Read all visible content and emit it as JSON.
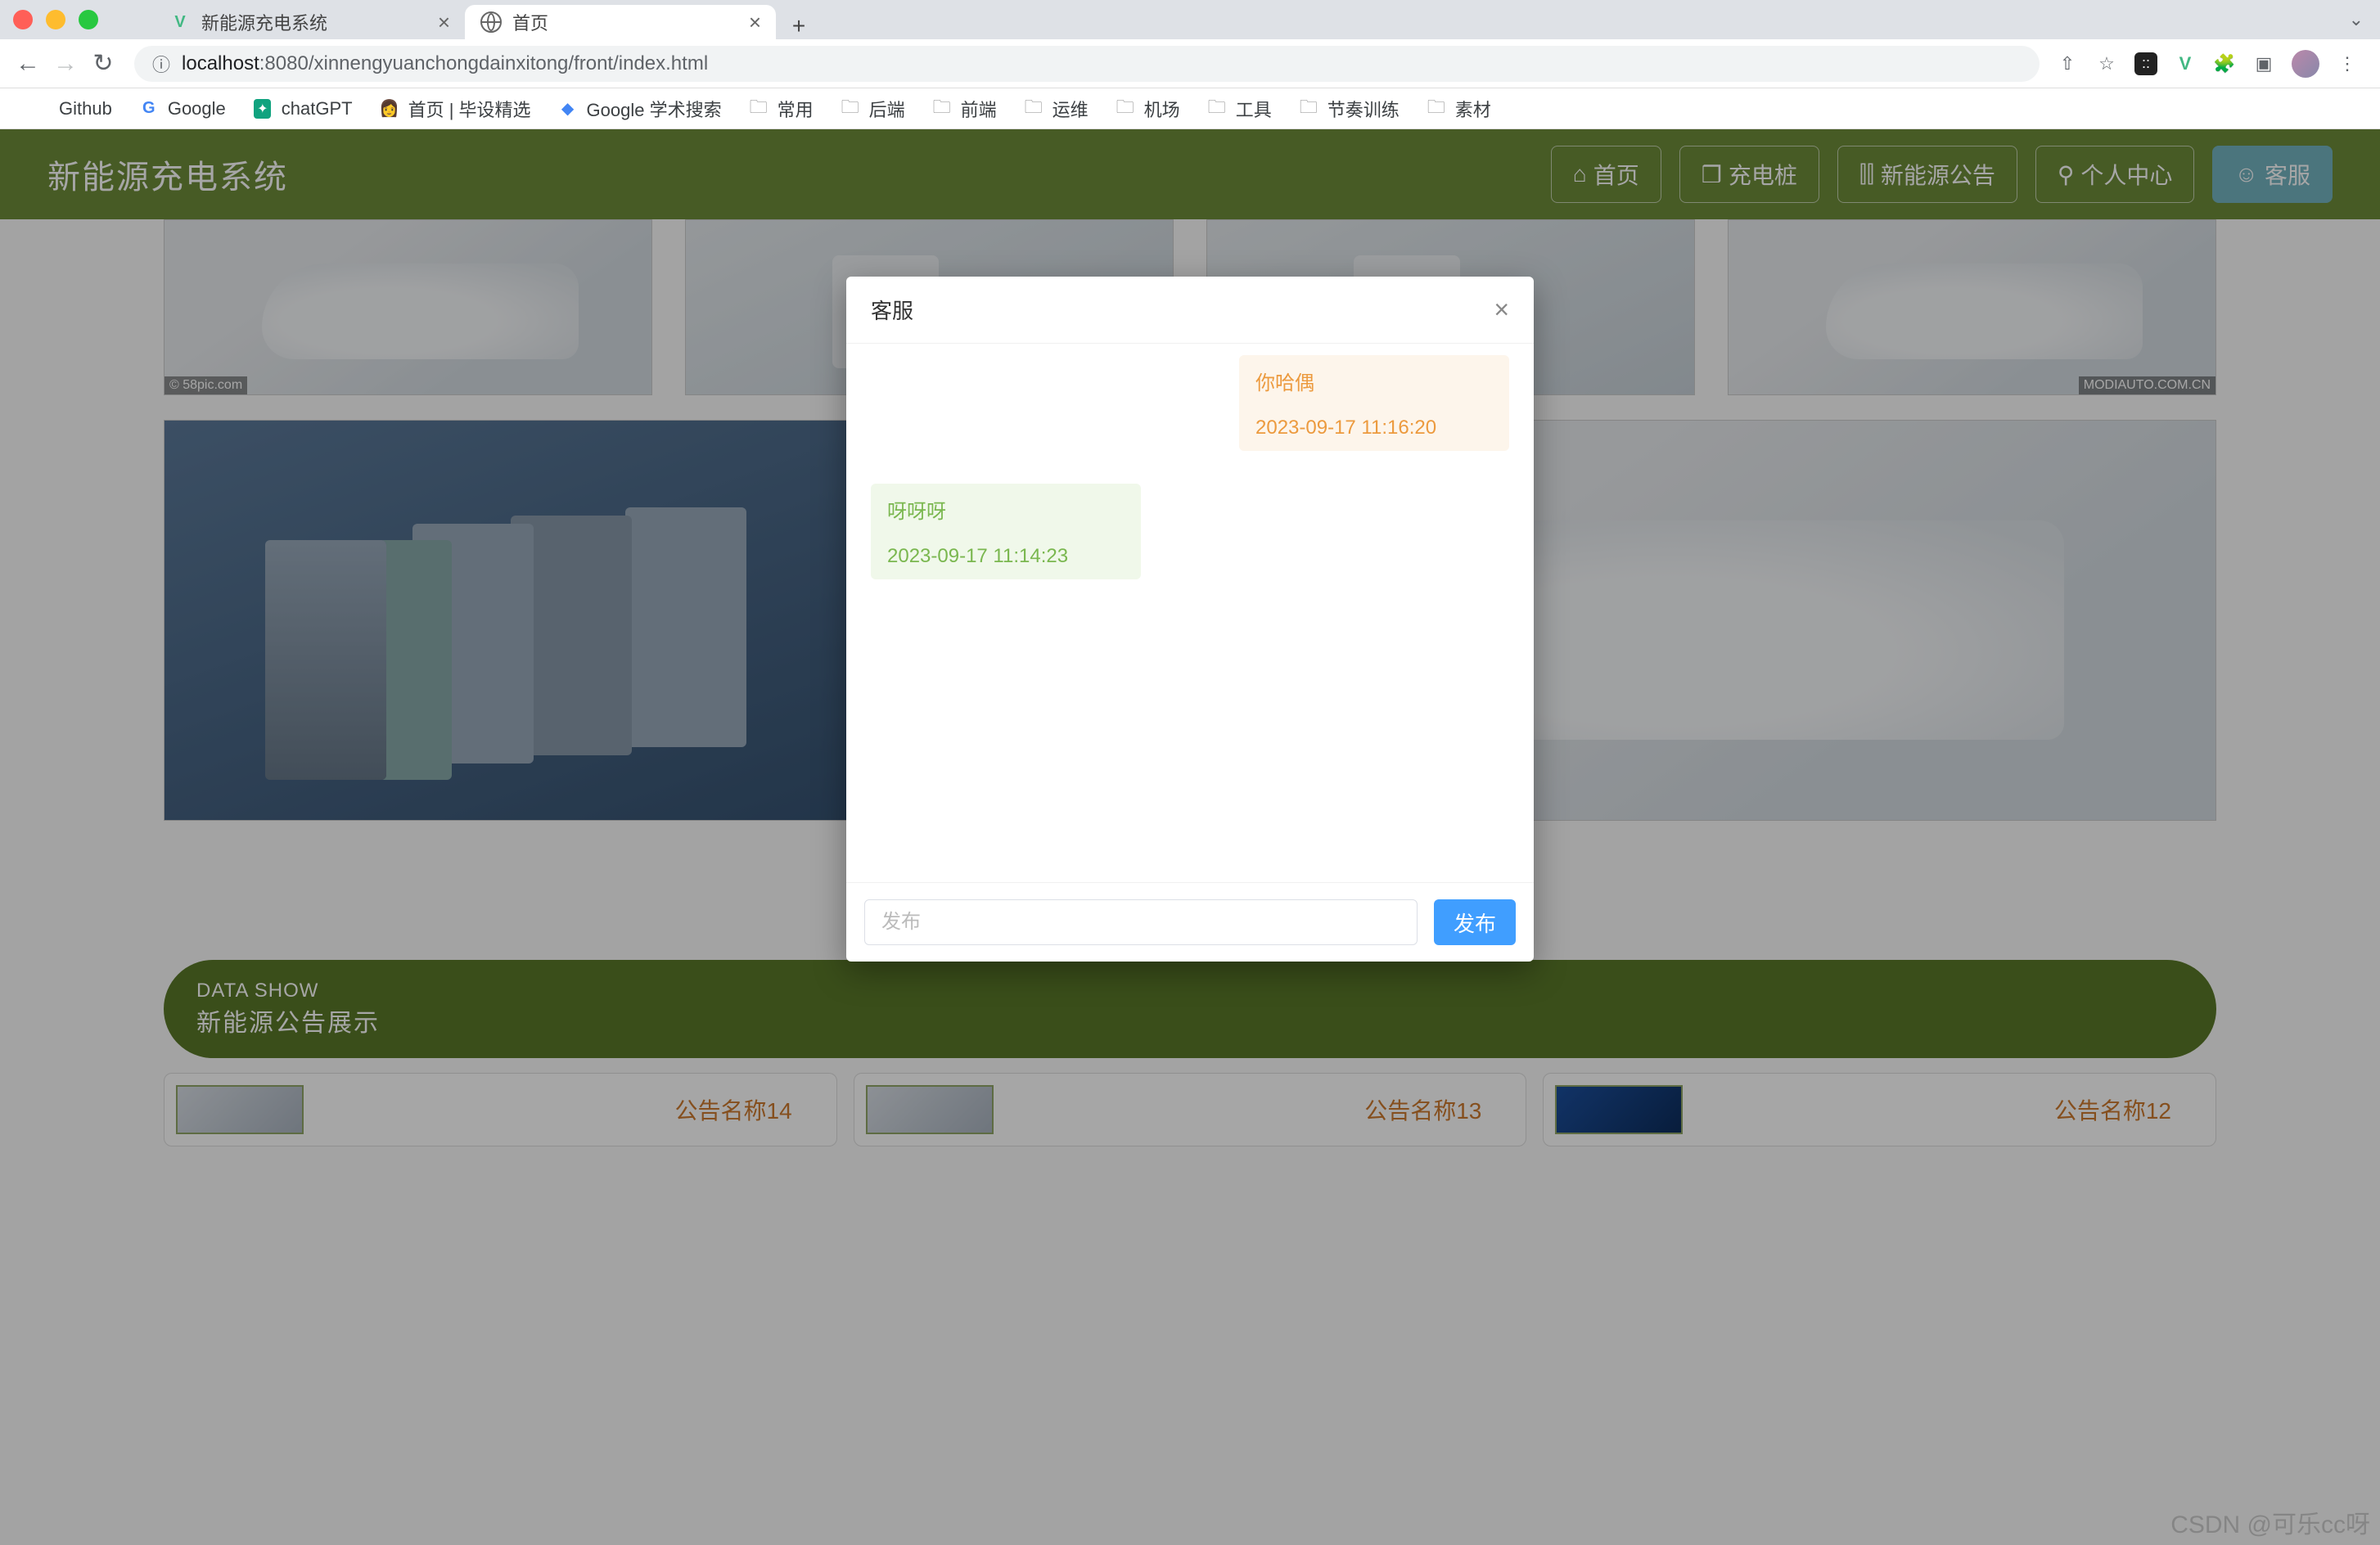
{
  "browser": {
    "tabs": [
      {
        "title": "新能源充电系统",
        "favicon": "vue"
      },
      {
        "title": "首页",
        "favicon": "globe",
        "active": true
      }
    ],
    "new_tab": "+",
    "nav": {
      "back": "←",
      "fwd": "→",
      "reload": "↻"
    },
    "url": {
      "scheme_icon": "ⓘ",
      "host": "localhost",
      "port": ":8080",
      "path": "/xinnengyuanchongdainxitong/front/index.html"
    },
    "right_icons": {
      "share": "⇧",
      "star": "☆",
      "panda": "::",
      "vue": "V",
      "puzzle": "🧩",
      "sidepanel": "▣",
      "menu": "⋮"
    },
    "bookmarks": [
      {
        "label": "Github",
        "icon": ""
      },
      {
        "label": "Google",
        "icon": "G"
      },
      {
        "label": "chatGPT",
        "icon": "◎"
      },
      {
        "label": "首页 | 毕设精选",
        "icon": "👩"
      },
      {
        "label": "Google 学术搜索",
        "icon": "◆"
      },
      {
        "label": "常用",
        "icon": "folder"
      },
      {
        "label": "后端",
        "icon": "folder"
      },
      {
        "label": "前端",
        "icon": "folder"
      },
      {
        "label": "运维",
        "icon": "folder"
      },
      {
        "label": "机场",
        "icon": "folder"
      },
      {
        "label": "工具",
        "icon": "folder"
      },
      {
        "label": "节奏训练",
        "icon": "folder"
      },
      {
        "label": "素材",
        "icon": "folder"
      }
    ]
  },
  "header": {
    "brand": "新能源充电系统",
    "nav_items": [
      {
        "icon": "⌂",
        "label": "首页"
      },
      {
        "icon": "❒",
        "label": "充电桩"
      },
      {
        "icon": "⫿⫿",
        "label": "新能源公告"
      },
      {
        "icon": "⚲",
        "label": "个人中心"
      },
      {
        "icon": "☺",
        "label": "客服",
        "accent": true
      }
    ]
  },
  "dialog": {
    "title": "客服",
    "close": "×",
    "messages": [
      {
        "side": "sent",
        "text": "你哈偶",
        "time": "2023-09-17 11:16:20"
      },
      {
        "side": "recv",
        "text": "呀呀呀",
        "time": "2023-09-17 11:14:23"
      }
    ],
    "input_placeholder": "发布",
    "send_label": "发布"
  },
  "datashow": {
    "line1": "DATA SHOW",
    "line2": "新能源公告展示"
  },
  "announcements": [
    {
      "title": "公告名称14",
      "thumb": "light"
    },
    {
      "title": "公告名称13",
      "thumb": "light"
    },
    {
      "title": "公告名称12",
      "thumb": "dark"
    }
  ],
  "watermark": "CSDN @可乐cc呀"
}
